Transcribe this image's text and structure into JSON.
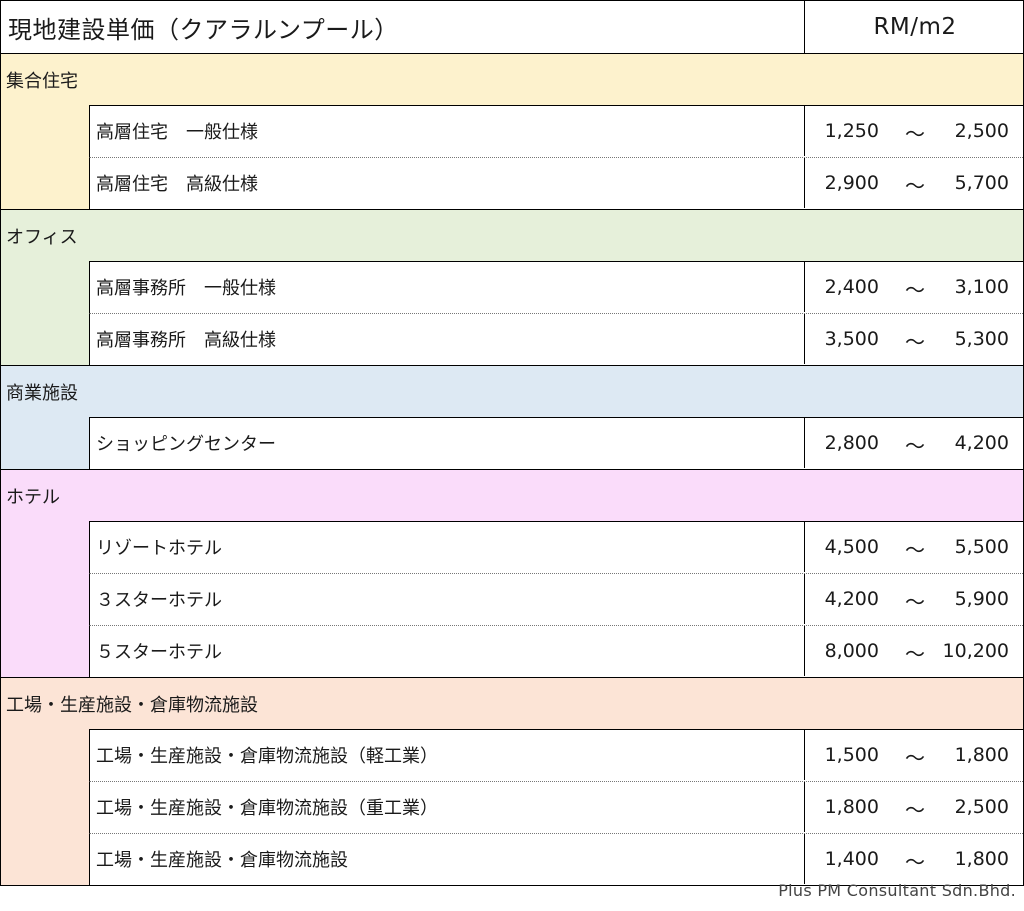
{
  "header": {
    "title": "現地建設単価（クアラルンプール）",
    "unit": "RM/m2"
  },
  "tilde": "～",
  "categories": [
    {
      "name": "集合住宅",
      "color": "#fdf2cd",
      "items": [
        {
          "name": "高層住宅　一般仕様",
          "low": "1,250",
          "high": "2,500"
        },
        {
          "name": "高層住宅　高級仕様",
          "low": "2,900",
          "high": "5,700"
        }
      ]
    },
    {
      "name": "オフィス",
      "color": "#e6f0da",
      "items": [
        {
          "name": "高層事務所　一般仕様",
          "low": "2,400",
          "high": "3,100"
        },
        {
          "name": "高層事務所　高級仕様",
          "low": "3,500",
          "high": "5,300"
        }
      ]
    },
    {
      "name": "商業施設",
      "color": "#dde9f3",
      "items": [
        {
          "name": "ショッピングセンター",
          "low": "2,800",
          "high": "4,200"
        }
      ]
    },
    {
      "name": "ホテル",
      "color": "#fadcfa",
      "items": [
        {
          "name": "リゾートホテル",
          "low": "4,500",
          "high": "5,500"
        },
        {
          "name": "３スターホテル",
          "low": "4,200",
          "high": "5,900"
        },
        {
          "name": "５スターホテル",
          "low": "8,000",
          "high": "10,200"
        }
      ]
    },
    {
      "name": "工場・生産施設・倉庫物流施設",
      "color": "#fce4d6",
      "items": [
        {
          "name": "工場・生産施設・倉庫物流施設（軽工業）",
          "low": "1,500",
          "high": "1,800"
        },
        {
          "name": "工場・生産施設・倉庫物流施設（重工業）",
          "low": "1,800",
          "high": "2,500"
        },
        {
          "name": "工場・生産施設・倉庫物流施設",
          "low": "1,400",
          "high": "1,800"
        }
      ]
    }
  ],
  "credit": "Plus PM Consultant Sdn.Bhd."
}
